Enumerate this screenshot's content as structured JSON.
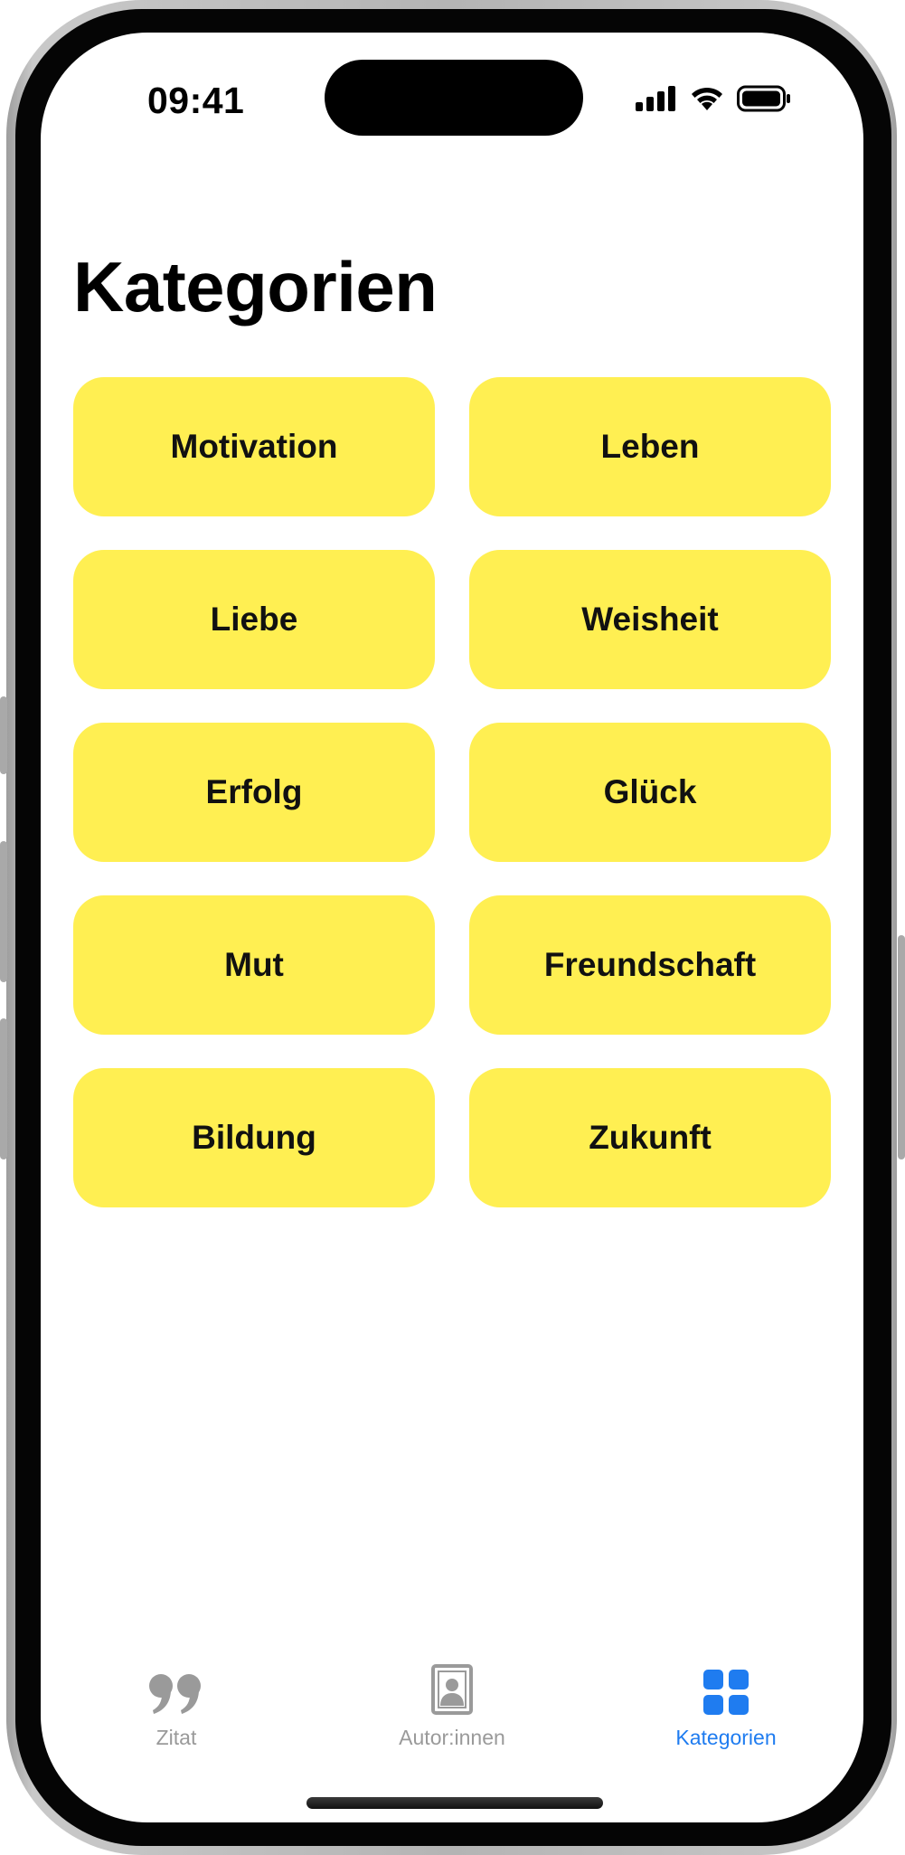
{
  "status_bar": {
    "time": "09:41"
  },
  "page": {
    "title": "Kategorien"
  },
  "categories": [
    {
      "label": "Motivation"
    },
    {
      "label": "Leben"
    },
    {
      "label": "Liebe"
    },
    {
      "label": "Weisheit"
    },
    {
      "label": "Erfolg"
    },
    {
      "label": "Glück"
    },
    {
      "label": "Mut"
    },
    {
      "label": "Freundschaft"
    },
    {
      "label": "Bildung"
    },
    {
      "label": "Zukunft"
    }
  ],
  "tab_bar": {
    "tabs": [
      {
        "label": "Zitat",
        "icon": "quote-icon",
        "active": false
      },
      {
        "label": "Autor:innen",
        "icon": "person-portrait-icon",
        "active": false
      },
      {
        "label": "Kategorien",
        "icon": "grid-icon",
        "active": true
      }
    ]
  },
  "colors": {
    "card_background": "#ffef52",
    "accent": "#1f7cf0",
    "inactive_tab": "#9a9a9a"
  }
}
